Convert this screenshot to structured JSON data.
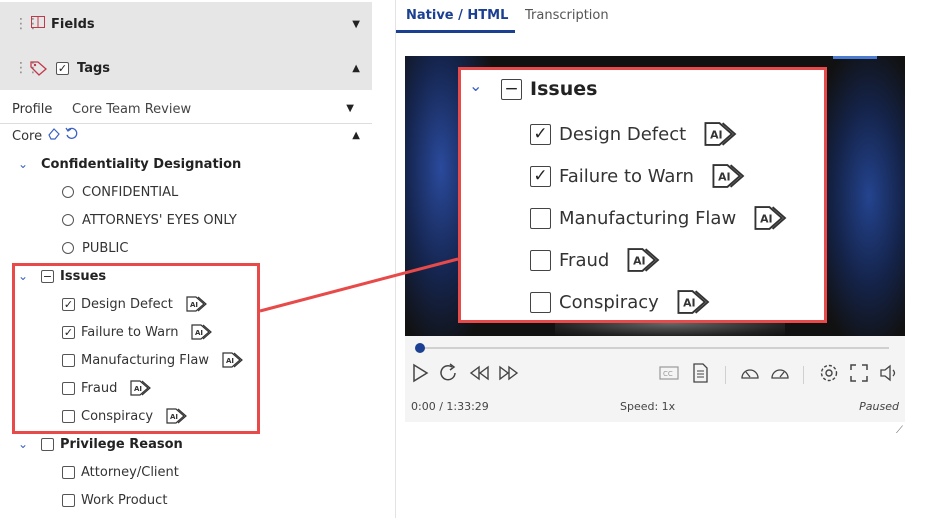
{
  "left_panel": {
    "fields_header": {
      "title": "Fields"
    },
    "tags_header": {
      "title": "Tags"
    },
    "profile": {
      "label": "Profile",
      "value": "Core Team Review"
    },
    "core": {
      "label": "Core"
    },
    "confidentiality": {
      "title": "Confidentiality Designation",
      "options": [
        "CONFIDENTIAL",
        "ATTORNEYS' EYES ONLY",
        "PUBLIC"
      ]
    },
    "issues": {
      "title": "Issues",
      "items": [
        {
          "label": "Design Defect",
          "checked": true
        },
        {
          "label": "Failure to Warn",
          "checked": true
        },
        {
          "label": "Manufacturing Flaw",
          "checked": false
        },
        {
          "label": "Fraud",
          "checked": false
        },
        {
          "label": "Conspiracy",
          "checked": false
        }
      ]
    },
    "privilege": {
      "title": "Privilege Reason",
      "items": [
        {
          "label": "Attorney/Client",
          "checked": false
        },
        {
          "label": "Work Product",
          "checked": false
        }
      ]
    }
  },
  "viewer": {
    "tabs": [
      {
        "label": "Native / HTML",
        "active": true
      },
      {
        "label": "Transcription",
        "active": false
      }
    ],
    "zoom_callout": {
      "title": "Issues",
      "items": [
        "Design Defect",
        "Failure to Warn",
        "Manufacturing Flaw",
        "Fraud",
        "Conspiracy"
      ]
    },
    "player": {
      "time": "0:00 / 1:33:29",
      "speed": "Speed: 1x",
      "status": "Paused",
      "progress": 0
    }
  },
  "colors": {
    "accent": "#1b3f91",
    "highlight": "#e84a4a",
    "chevron": "#3a62c4",
    "header_bg": "#e6e6e6"
  }
}
